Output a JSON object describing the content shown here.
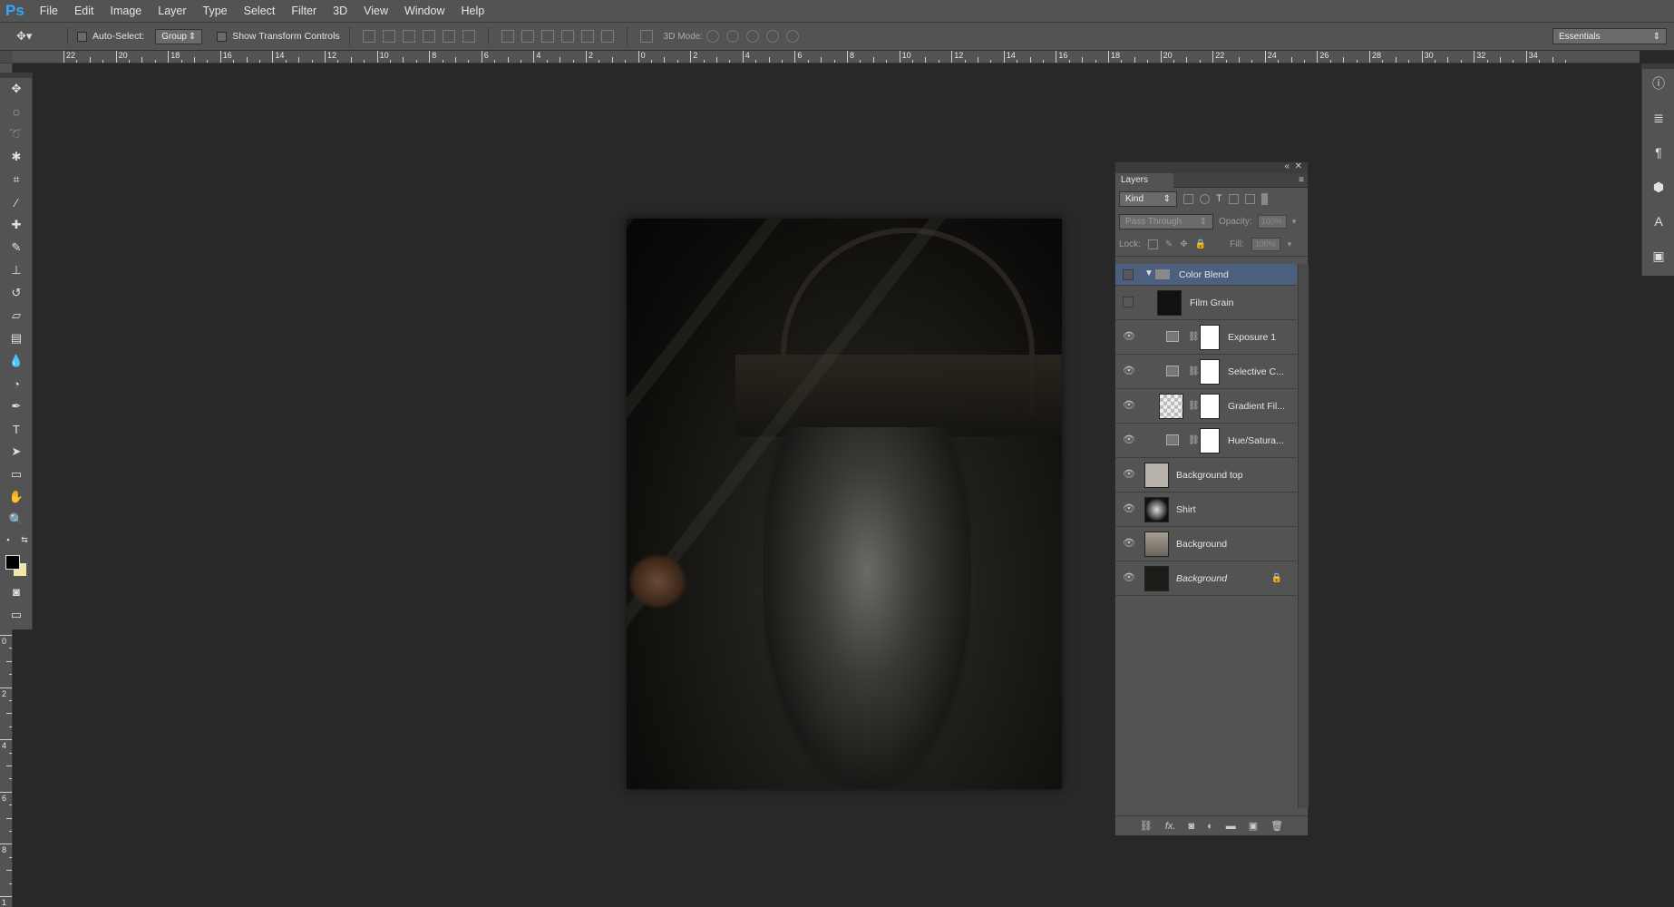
{
  "app": {
    "logo": "Ps"
  },
  "menu": [
    "File",
    "Edit",
    "Image",
    "Layer",
    "Type",
    "Select",
    "Filter",
    "3D",
    "View",
    "Window",
    "Help"
  ],
  "options": {
    "auto_select_label": "Auto-Select:",
    "auto_select_target": "Group",
    "show_transform_label": "Show Transform Controls",
    "mode3d_label": "3D Mode:",
    "workspace": "Essentials"
  },
  "ruler_h_labels": [
    "22",
    "20",
    "18",
    "16",
    "14",
    "12",
    "10",
    "8",
    "6",
    "4",
    "2",
    "0",
    "2",
    "4",
    "6",
    "8",
    "10",
    "12",
    "14",
    "16",
    "18",
    "20",
    "22",
    "24",
    "26",
    "28",
    "30",
    "32",
    "34"
  ],
  "ruler_v_labels": [
    "0",
    "2",
    "4",
    "6",
    "8",
    "1"
  ],
  "layers_panel": {
    "tab": "Layers",
    "filter_kind": "Kind",
    "blend_mode": "Pass Through",
    "opacity_label": "Opacity:",
    "opacity_value": "100%",
    "lock_label": "Lock:",
    "fill_label": "Fill:",
    "fill_value": "100%",
    "layers": [
      {
        "name": "Color Blend",
        "type": "group",
        "visible": false,
        "selected": true
      },
      {
        "name": "Film Grain",
        "type": "pixel",
        "visible": false,
        "thumb": "#111111"
      },
      {
        "name": "Exposure 1",
        "type": "adjustment",
        "visible": true
      },
      {
        "name": "Selective C...",
        "type": "adjustment",
        "visible": true
      },
      {
        "name": "Gradient Fil...",
        "type": "gradient",
        "visible": true
      },
      {
        "name": "Hue/Satura...",
        "type": "adjustment",
        "visible": true
      },
      {
        "name": "Background top",
        "type": "pixel",
        "visible": true,
        "thumb": "#b9b4ab"
      },
      {
        "name": "Shirt",
        "type": "pixel",
        "visible": true,
        "thumb": "#2a2a2a"
      },
      {
        "name": "Background",
        "type": "pixel",
        "visible": true,
        "thumb": "#8d877b"
      },
      {
        "name": "Background",
        "type": "background",
        "visible": true,
        "thumb": "#1e1c18",
        "locked": true
      }
    ]
  },
  "colors": {
    "foreground": "#000000",
    "background": "#f1e6a9",
    "selection": "#4a607e"
  }
}
